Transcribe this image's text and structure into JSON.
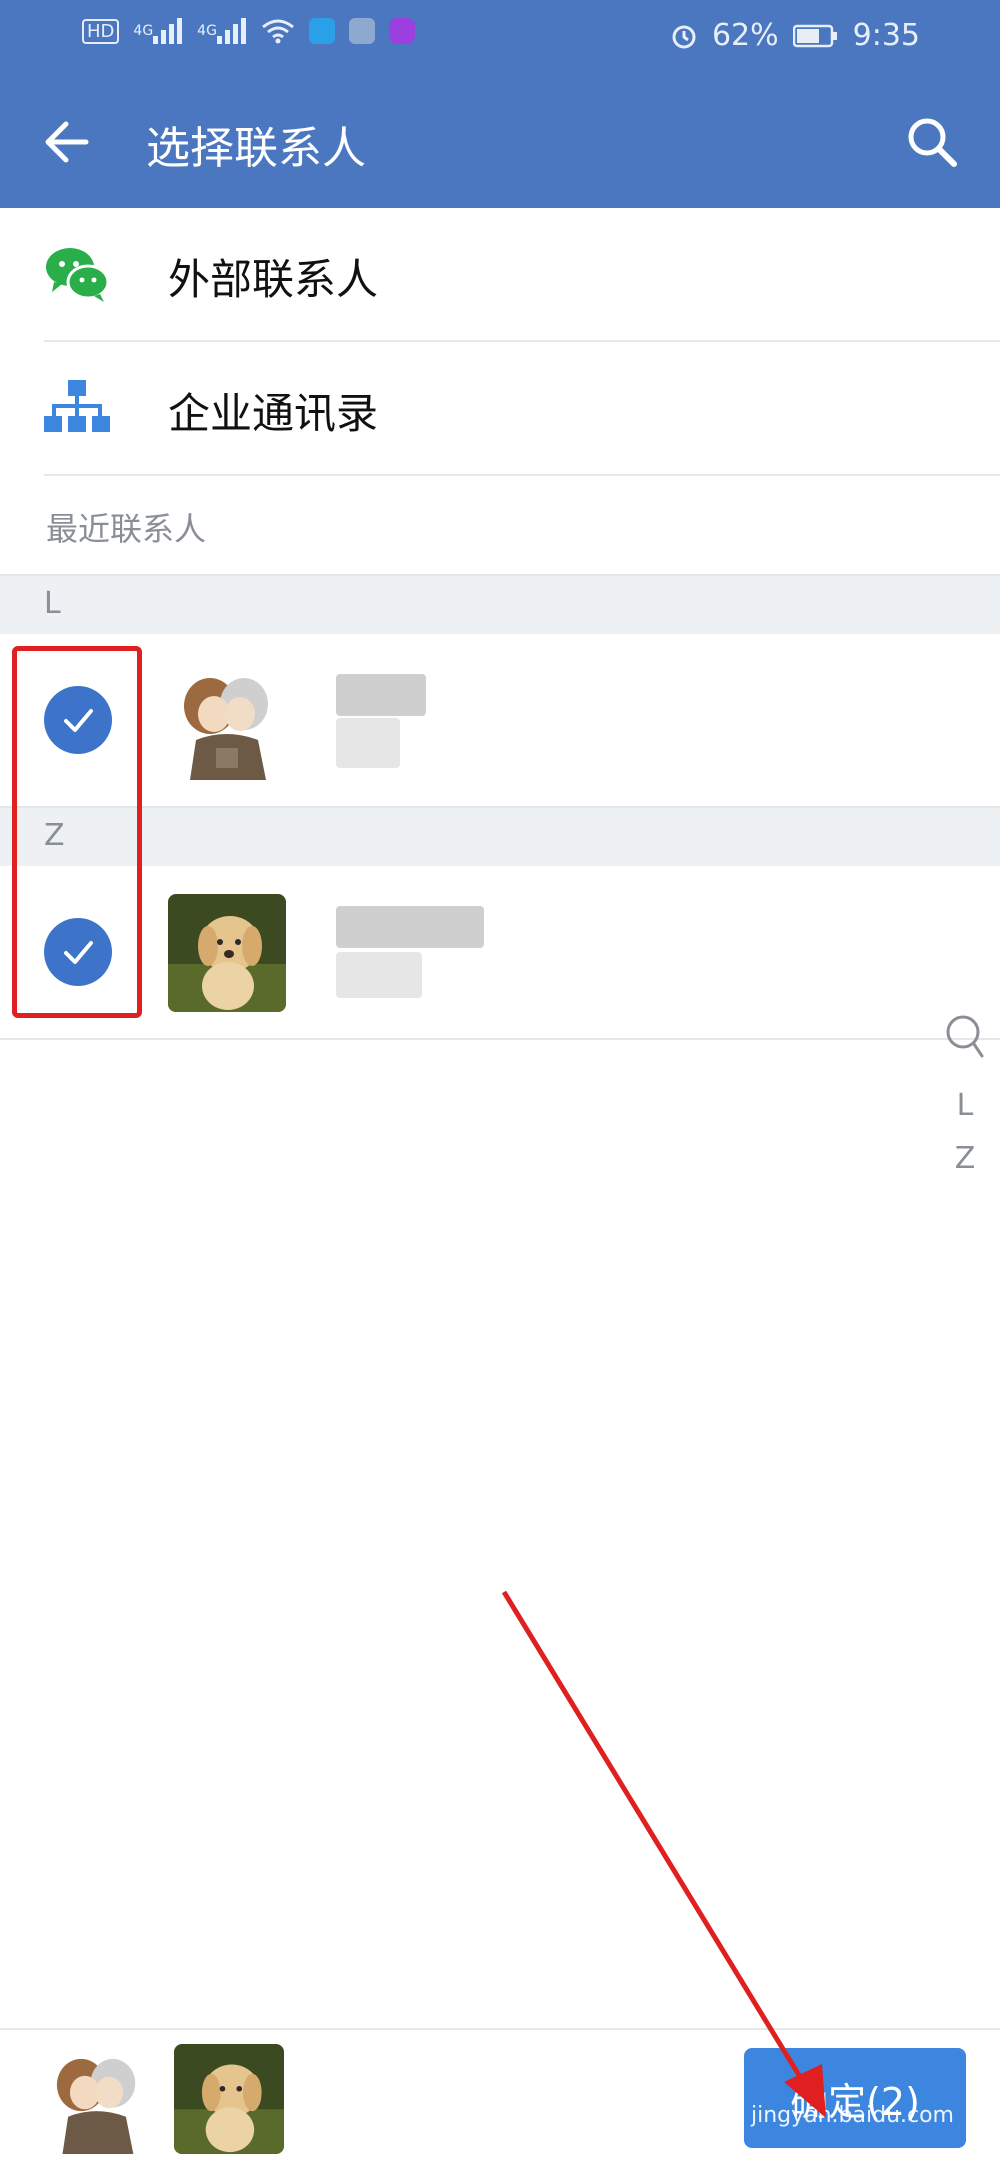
{
  "status_bar": {
    "hd_label": "HD",
    "signal_1": "4G",
    "signal_2": "4G",
    "battery_percent": "62%",
    "time": "9:35"
  },
  "header": {
    "title": "选择联系人"
  },
  "entries": [
    {
      "label": "外部联系人",
      "icon": "wechat-icon"
    },
    {
      "label": "企业通讯录",
      "icon": "org-chart-icon"
    }
  ],
  "recent_label": "最近联系人",
  "groups": [
    {
      "letter": "L",
      "contacts": [
        {
          "checked": true,
          "avatar": "anime-couple"
        }
      ]
    },
    {
      "letter": "Z",
      "contacts": [
        {
          "checked": true,
          "avatar": "puppy"
        }
      ]
    }
  ],
  "index_bar": [
    "L",
    "Z"
  ],
  "bottom": {
    "confirm_label": "确定(2)",
    "watermark": "jingyan.baidu.com"
  },
  "colors": {
    "header_bg": "#4a77c0",
    "check": "#3d73c9",
    "confirm_bg": "#3d86e0",
    "annotation_red": "#e02020"
  }
}
